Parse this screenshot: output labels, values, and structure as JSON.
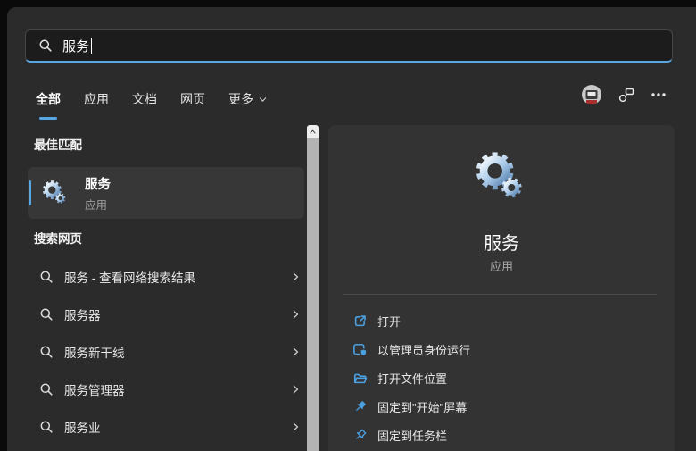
{
  "colors": {
    "accent": "#57a7e3",
    "action_icon_blue": "#4ba0e0",
    "window_bg": "#2b2b2c",
    "panel_bg": "#333334"
  },
  "search": {
    "value": "服务"
  },
  "tabs": {
    "items": [
      {
        "label": "全部",
        "active": true
      },
      {
        "label": "应用",
        "active": false
      },
      {
        "label": "文档",
        "active": false
      },
      {
        "label": "网页",
        "active": false
      },
      {
        "label": "更多",
        "active": false,
        "has_chevron": true
      }
    ]
  },
  "left": {
    "best_match_header": "最佳匹配",
    "best_match": {
      "title": "服务",
      "subtitle": "应用"
    },
    "web_header": "搜索网页",
    "web_items": [
      "服务 - 查看网络搜索结果",
      "服务器",
      "服务新干线",
      "服务管理器",
      "服务业"
    ]
  },
  "right": {
    "app_title": "服务",
    "app_subtitle": "应用",
    "actions": [
      {
        "label": "打开",
        "icon": "open-icon"
      },
      {
        "label": "以管理员身份运行",
        "icon": "run-as-admin-icon"
      },
      {
        "label": "打开文件位置",
        "icon": "folder-icon"
      },
      {
        "label": "固定到\"开始\"屏幕",
        "icon": "pin-filled-icon"
      },
      {
        "label": "固定到任务栏",
        "icon": "pin-outline-icon"
      }
    ]
  }
}
